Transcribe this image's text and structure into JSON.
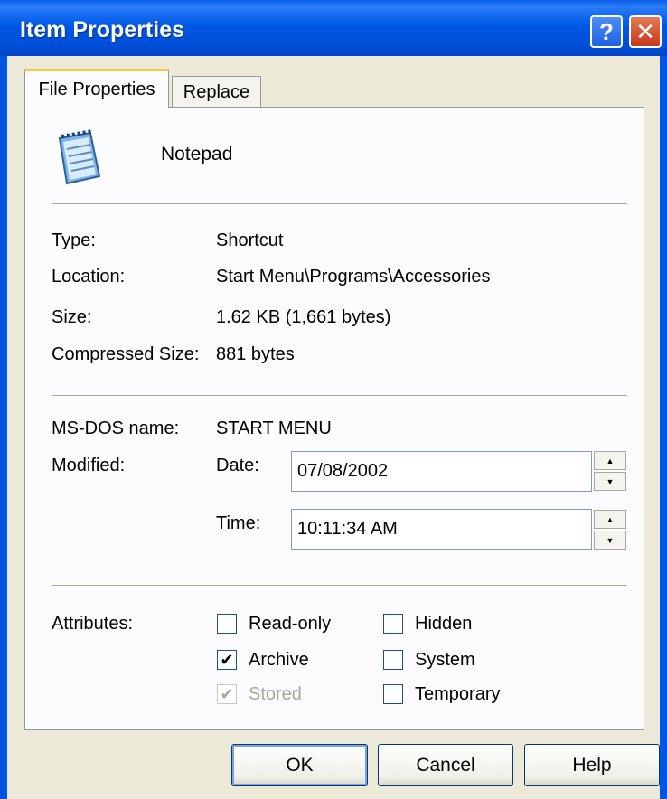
{
  "window": {
    "title": "Item Properties",
    "help_glyph": "?",
    "close_glyph": "✕"
  },
  "tabs": [
    {
      "label": "File Properties",
      "active": true
    },
    {
      "label": "Replace",
      "active": false
    }
  ],
  "item": {
    "name": "Notepad",
    "icon": "notepad-icon"
  },
  "details": {
    "type_label": "Type:",
    "type_value": "Shortcut",
    "location_label": "Location:",
    "location_value": "Start Menu\\Programs\\Accessories",
    "size_label": "Size:",
    "size_value": "1.62 KB (1,661 bytes)",
    "compressed_label": "Compressed Size:",
    "compressed_value": "881 bytes"
  },
  "dos": {
    "msdos_label": "MS-DOS name:",
    "msdos_value": "START MENU",
    "modified_label": "Modified:",
    "date_label": "Date:",
    "date_value": "07/08/2002",
    "time_label": "Time:",
    "time_value": "10:11:34 AM",
    "spin_up": "▲",
    "spin_down": "▼"
  },
  "attributes": {
    "label": "Attributes:",
    "check_mark": "✔",
    "items": [
      {
        "label": "Read-only",
        "checked": false,
        "enabled": true
      },
      {
        "label": "Hidden",
        "checked": false,
        "enabled": true
      },
      {
        "label": "Archive",
        "checked": true,
        "enabled": true
      },
      {
        "label": "System",
        "checked": false,
        "enabled": true
      },
      {
        "label": "Stored",
        "checked": true,
        "enabled": false
      },
      {
        "label": "Temporary",
        "checked": false,
        "enabled": true
      }
    ]
  },
  "buttons": {
    "ok": "OK",
    "cancel": "Cancel",
    "help": "Help"
  },
  "colors": {
    "titlebar": "#0058e6",
    "dialog_bg": "#ece9d8",
    "close_red": "#c4391b"
  }
}
